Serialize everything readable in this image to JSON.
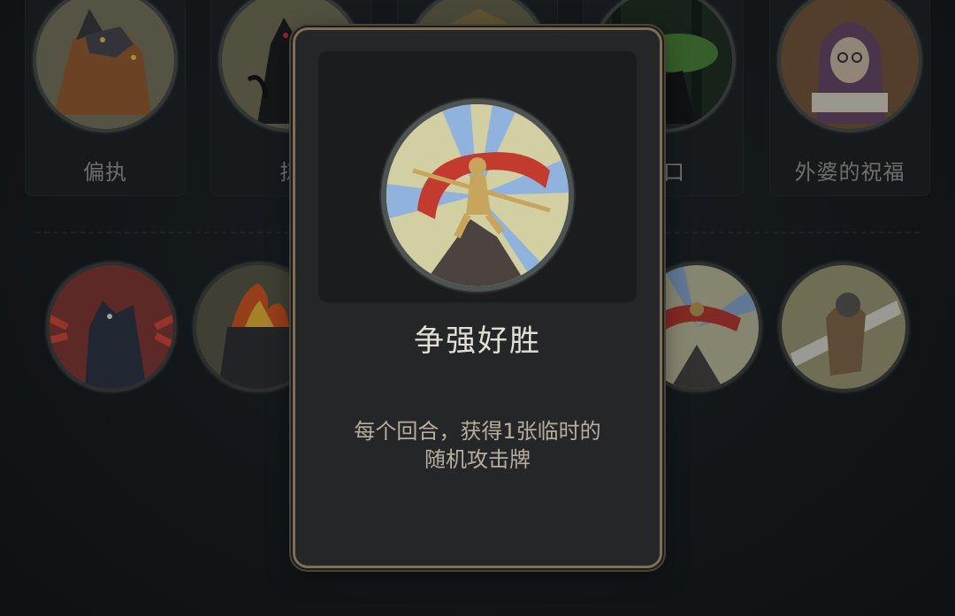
{
  "top_cards": [
    {
      "label": "偏执",
      "icon": "werewolf-portrait-icon"
    },
    {
      "label": "掠",
      "icon": "shadow-wolf-portrait-icon"
    },
    {
      "label": "",
      "icon": "camp-portrait-icon"
    },
    {
      "label": "路口",
      "icon": "crossroads-forest-portrait-icon"
    },
    {
      "label": "外婆的祝福",
      "icon": "grandmother-reading-portrait-icon"
    }
  ],
  "bottom_tokens": [
    {
      "icon": "werewolf-howl-icon"
    },
    {
      "icon": "flaming-altar-icon"
    },
    {
      "icon": "competitive-fighter-icon"
    },
    {
      "icon": "sword-warrior-icon"
    }
  ],
  "modal": {
    "icon": "competitive-fighter-icon",
    "title": "争强好胜",
    "description_line1": "每个回合，获得1张临时的",
    "description_line2": "随机攻击牌"
  },
  "colors": {
    "background": "#161a1d",
    "modal_bg": "#252627",
    "modal_border": "#7c6f55",
    "title_text": "#e2dfd6",
    "desc_text": "#b7ad9e",
    "label_text": "#a6a29a"
  }
}
